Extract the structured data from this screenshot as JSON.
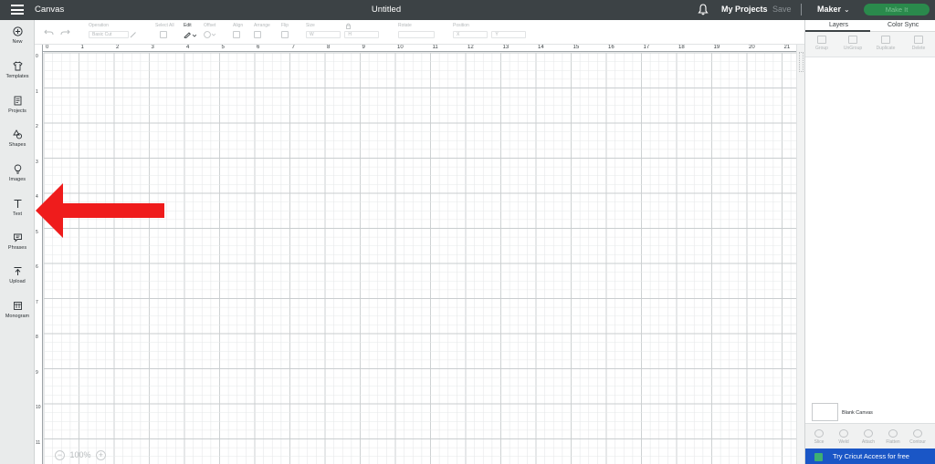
{
  "topbar": {
    "app_title": "Canvas",
    "doc_title": "Untitled",
    "my_projects": "My Projects",
    "save": "Save",
    "machine": "Maker",
    "make_it": "Make It"
  },
  "sidebar": {
    "items": [
      {
        "label": "New",
        "icon": "plus-circle-icon"
      },
      {
        "label": "Templates",
        "icon": "shirt-icon"
      },
      {
        "label": "Projects",
        "icon": "projects-icon"
      },
      {
        "label": "Shapes",
        "icon": "shapes-icon"
      },
      {
        "label": "Images",
        "icon": "lightbulb-icon"
      },
      {
        "label": "Text",
        "icon": "text-icon"
      },
      {
        "label": "Phrases",
        "icon": "speech-bubble-icon"
      },
      {
        "label": "Upload",
        "icon": "upload-icon"
      },
      {
        "label": "Monogram",
        "icon": "monogram-icon"
      }
    ]
  },
  "toolbar": {
    "operation_label": "Operation",
    "operation_value": "Basic Cut",
    "select_all": "Select All",
    "edit": "Edit",
    "offset": "Offset",
    "align": "Align",
    "arrange": "Arrange",
    "flip": "Flip",
    "size": "Size",
    "size_w": "W",
    "size_h": "H",
    "rotate": "Rotate",
    "position": "Position",
    "pos_x": "X",
    "pos_y": "Y"
  },
  "ruler": {
    "top": [
      "0",
      "1",
      "2",
      "3",
      "4",
      "5",
      "6",
      "7",
      "8",
      "9",
      "10",
      "11",
      "12",
      "13",
      "14",
      "15",
      "16",
      "17",
      "18",
      "19",
      "20",
      "21"
    ],
    "left": [
      "0",
      "1",
      "2",
      "3",
      "4",
      "5",
      "6",
      "7",
      "8",
      "9",
      "10",
      "11"
    ]
  },
  "zoom": {
    "minus": "−",
    "level": "100%",
    "plus": "+"
  },
  "right_panel": {
    "tabs": [
      "Layers",
      "Color Sync"
    ],
    "tools": [
      "Group",
      "UnGroup",
      "Duplicate",
      "Delete"
    ],
    "blank_canvas": "Blank Canvas",
    "bottom_tools": [
      "Slice",
      "Weld",
      "Attach",
      "Flatten",
      "Contour"
    ],
    "access_banner": "Try Cricut Access for free"
  },
  "colors": {
    "topbar": "#3c4245",
    "make_it": "#2a8a4c",
    "arrow": "#ef1c1c",
    "access": "#1a56c6"
  }
}
